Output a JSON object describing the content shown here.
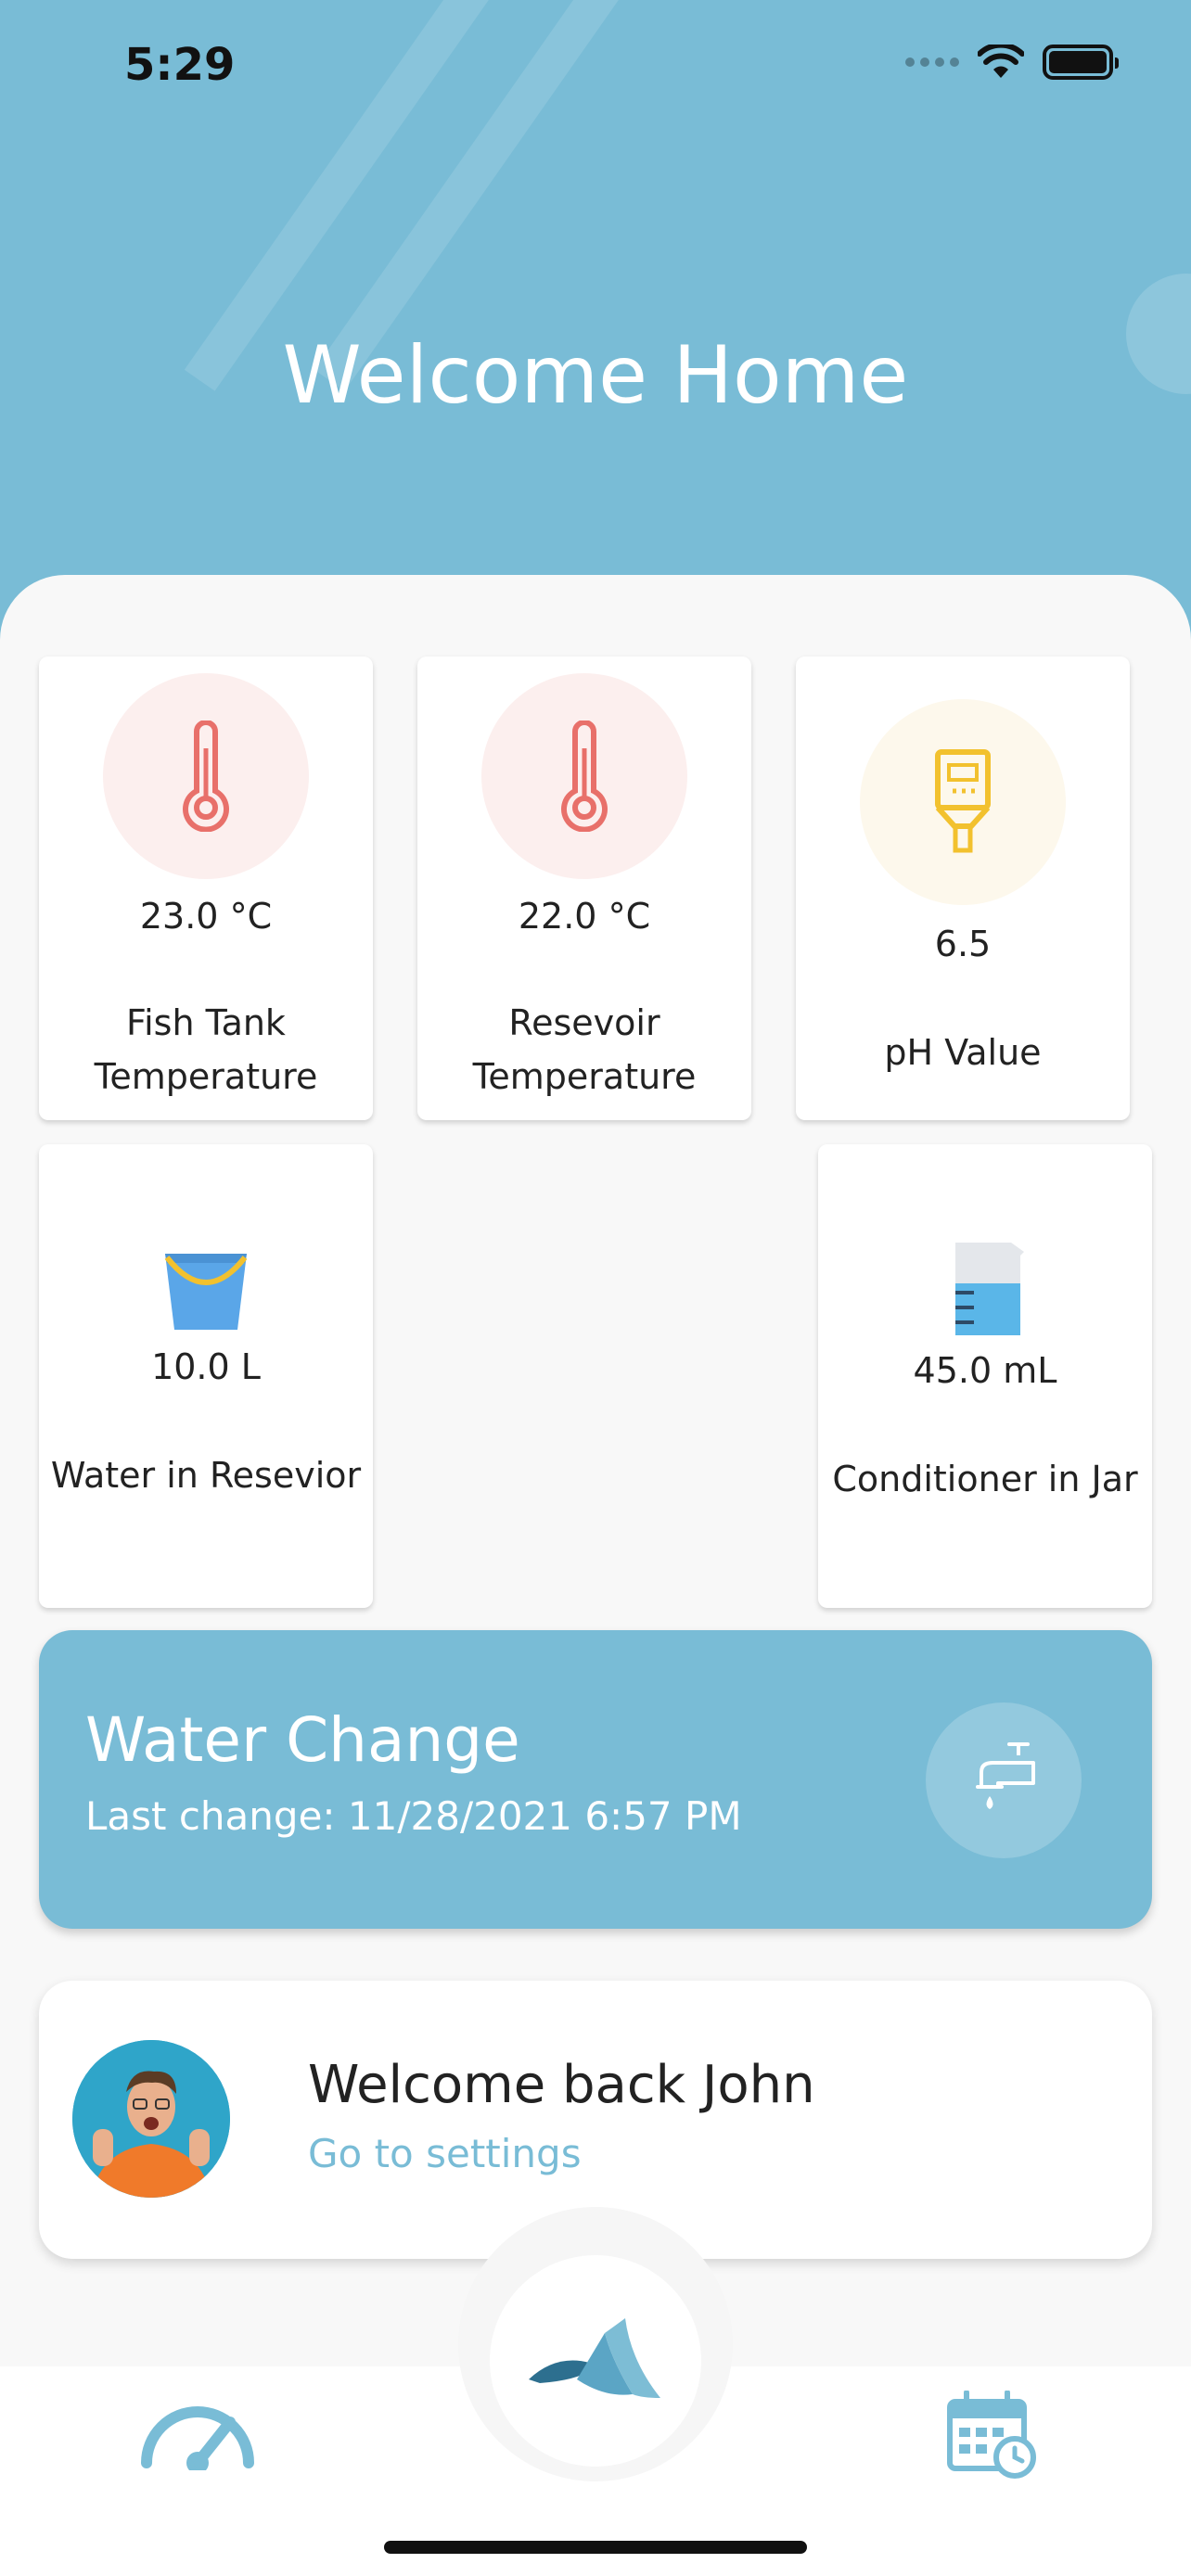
{
  "status_bar": {
    "time": "5:29"
  },
  "header": {
    "title": "Welcome Home"
  },
  "sensors": [
    {
      "value": "23.0 °C",
      "label_line1": "Fish Tank",
      "label_line2": "Temperature",
      "icon": "thermometer-icon"
    },
    {
      "value": "22.0 °C",
      "label_line1": "Resevoir",
      "label_line2": "Temperature",
      "icon": "thermometer-icon"
    },
    {
      "value": "6.5",
      "label": "pH Value",
      "icon": "ph-meter-icon"
    },
    {
      "value": "10.0 L",
      "label": "Water in Resevior",
      "icon": "bucket-icon"
    },
    {
      "value": "45.0 mL",
      "label": "Conditioner in Jar",
      "icon": "beaker-icon"
    }
  ],
  "water_change": {
    "title": "Water Change",
    "last_change": "Last change: 11/28/2021 6:57 PM",
    "icon": "faucet-icon"
  },
  "profile": {
    "greeting": "Welcome back John",
    "link": "Go to settings"
  },
  "tab_bar": {
    "left_icon": "speedometer-icon",
    "center_icon": "app-logo-icon",
    "right_icon": "calendar-clock-icon"
  },
  "colors": {
    "accent": "#79bcd6",
    "thermo_red": "#e8706a",
    "ph_yellow": "#f2c12e",
    "bucket_blue": "#5aa6e8"
  }
}
